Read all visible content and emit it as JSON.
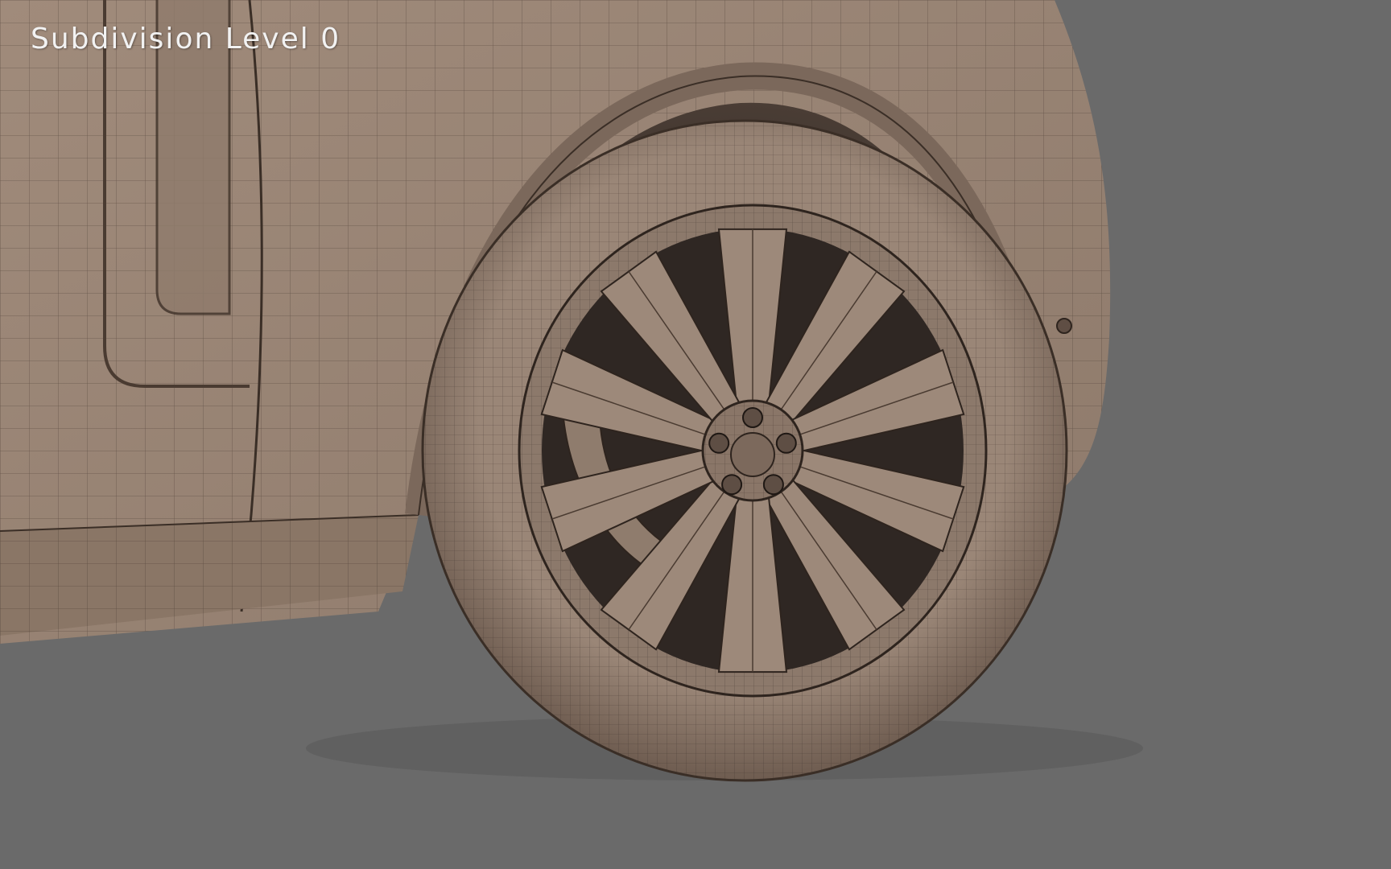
{
  "viewport": {
    "overlay_label": "Subdivision Level 0",
    "subject": "car-front-wheel-wireframe-mesh",
    "colors": {
      "background": "#6a6a6a",
      "clay_body": "#9c8878",
      "clay_dark": "#5a4a40",
      "wire": "#2e241e",
      "label_text": "#f2f2f2"
    }
  }
}
